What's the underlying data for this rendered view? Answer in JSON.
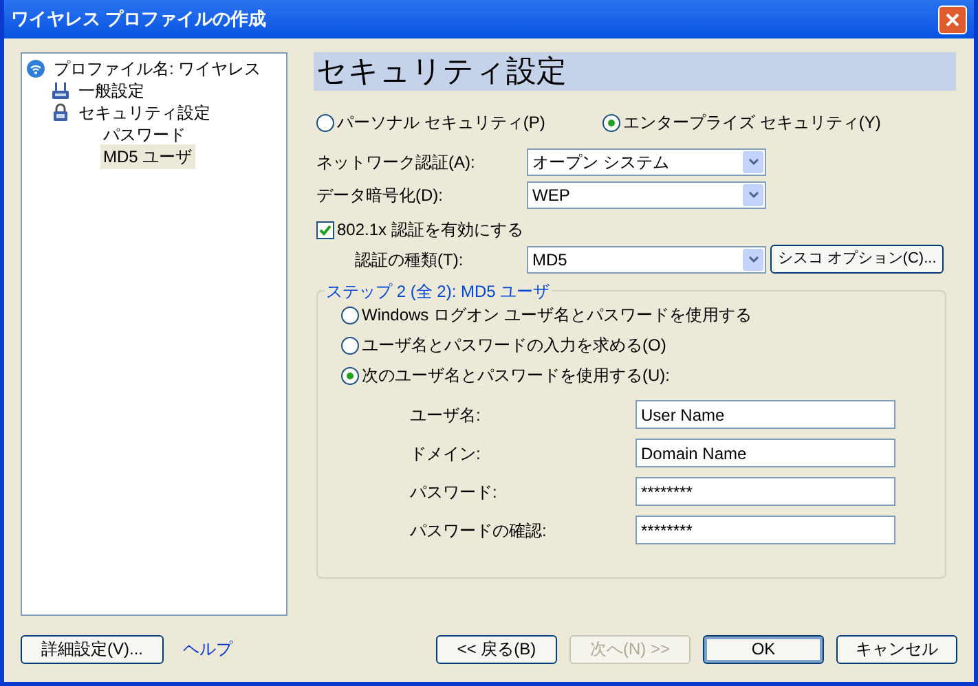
{
  "window": {
    "title": "ワイヤレス プロファイルの作成"
  },
  "tree": [
    {
      "label": "プロファイル名: ワイヤレス",
      "kind": "wifi",
      "selected": false,
      "children": [
        {
          "label": "一般設定",
          "kind": "router",
          "selected": false
        },
        {
          "label": "セキュリティ設定",
          "kind": "lock",
          "selected": false,
          "children": [
            {
              "label": "パスワード",
              "kind": "none",
              "selected": false
            },
            {
              "label": "MD5 ユーザ",
              "kind": "none",
              "selected": true
            }
          ]
        }
      ]
    }
  ],
  "header": "セキュリティ設定",
  "security_modes": [
    {
      "label": "パーソナル セキュリティ(P)",
      "selected": false
    },
    {
      "label": "エンタープライズ セキュリティ(Y)",
      "selected": true
    }
  ],
  "dropdowns": [
    {
      "label": "ネットワーク認証(A):",
      "value": "オープン システム"
    },
    {
      "label": "データ暗号化(D):",
      "value": "WEP"
    }
  ],
  "enable_8021x": {
    "label": "802.1x 認証を有効にする",
    "checked": true
  },
  "auth_type": {
    "label": "認証の種類(T):",
    "value": "MD5",
    "button": "シスコ オプション(C)..."
  },
  "step_group": {
    "title": "ステップ 2 (全 2): MD5 ユーザ",
    "options": [
      {
        "label": "Windows ログオン ユーザ名とパスワードを使用する",
        "selected": false
      },
      {
        "label": "ユーザ名とパスワードの入力を求める(O)",
        "selected": false
      },
      {
        "label": "次のユーザ名とパスワードを使用する(U):",
        "selected": true
      }
    ],
    "fields": [
      {
        "label": "ユーザ名:",
        "value": "User Name"
      },
      {
        "label": "ドメイン:",
        "value": "Domain Name"
      },
      {
        "label": "パスワード:",
        "value": "********"
      },
      {
        "label": "パスワードの確認:",
        "value": "********"
      }
    ]
  },
  "footer_left": [
    {
      "label": "詳細設定(V)...",
      "kind": "button"
    },
    {
      "label": "ヘルプ",
      "kind": "link"
    }
  ],
  "footer_right": [
    {
      "label": "<< 戻る(B)",
      "disabled": false,
      "default": false
    },
    {
      "label": "次へ(N) >>",
      "disabled": true,
      "default": false
    },
    {
      "label": "OK",
      "disabled": false,
      "default": true
    },
    {
      "label": "キャンセル",
      "disabled": false,
      "default": false
    }
  ]
}
